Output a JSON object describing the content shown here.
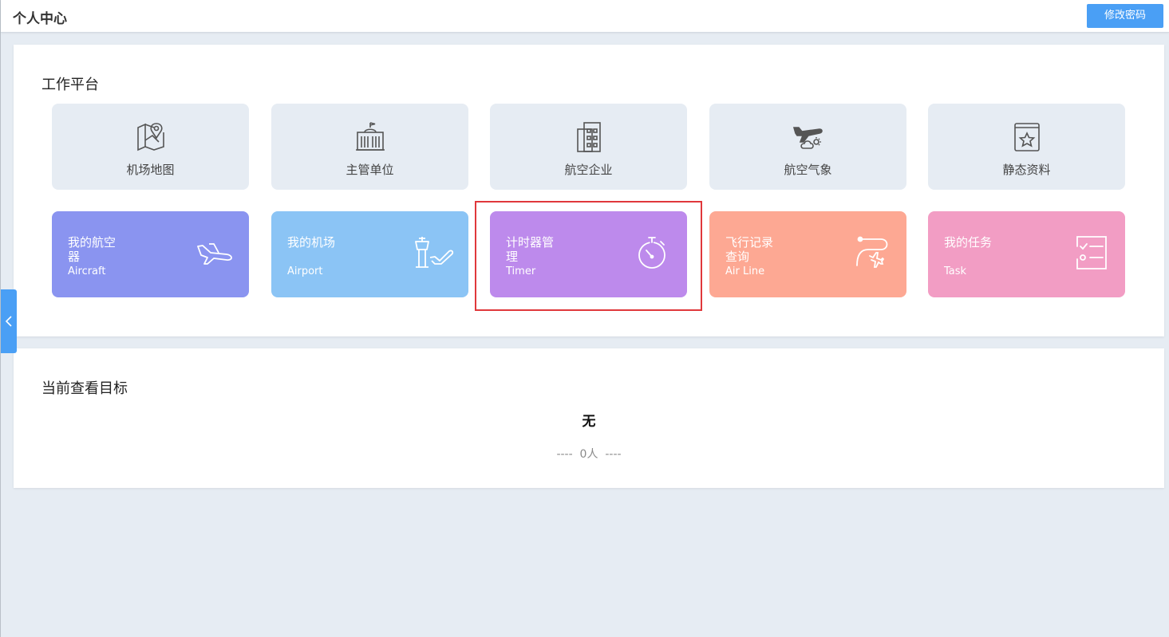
{
  "header": {
    "title": "个人中心",
    "change_password_label": "修改密码"
  },
  "work_platform": {
    "title": "工作平台",
    "tiles": [
      {
        "label": "机场地图",
        "icon": "map-pin-icon"
      },
      {
        "label": "主管单位",
        "icon": "government-building-icon"
      },
      {
        "label": "航空企业",
        "icon": "office-building-icon"
      },
      {
        "label": "航空气象",
        "icon": "plane-weather-icon"
      },
      {
        "label": "静态资料",
        "icon": "star-book-icon"
      }
    ],
    "cards": [
      {
        "cn": "我的航空器",
        "en": "Aircraft",
        "icon": "airplane-icon",
        "color": "#8a94f0"
      },
      {
        "cn": "我的机场",
        "en": "Airport",
        "icon": "control-tower-icon",
        "color": "#8bc4f5"
      },
      {
        "cn": "计时器管理",
        "en": "Timer",
        "icon": "stopwatch-icon",
        "color": "#bd8aec"
      },
      {
        "cn": "飞行记录查询",
        "en": "Air Line",
        "icon": "flight-route-icon",
        "color": "#fda893"
      },
      {
        "cn": "我的任务",
        "en": "Task",
        "icon": "checklist-icon",
        "color": "#f29dc4"
      }
    ]
  },
  "current_target": {
    "title": "当前查看目标",
    "value": "无",
    "count_text": "----  0人  ----"
  },
  "highlight_color": "#e0383b",
  "accent_color": "#4a9ff5"
}
